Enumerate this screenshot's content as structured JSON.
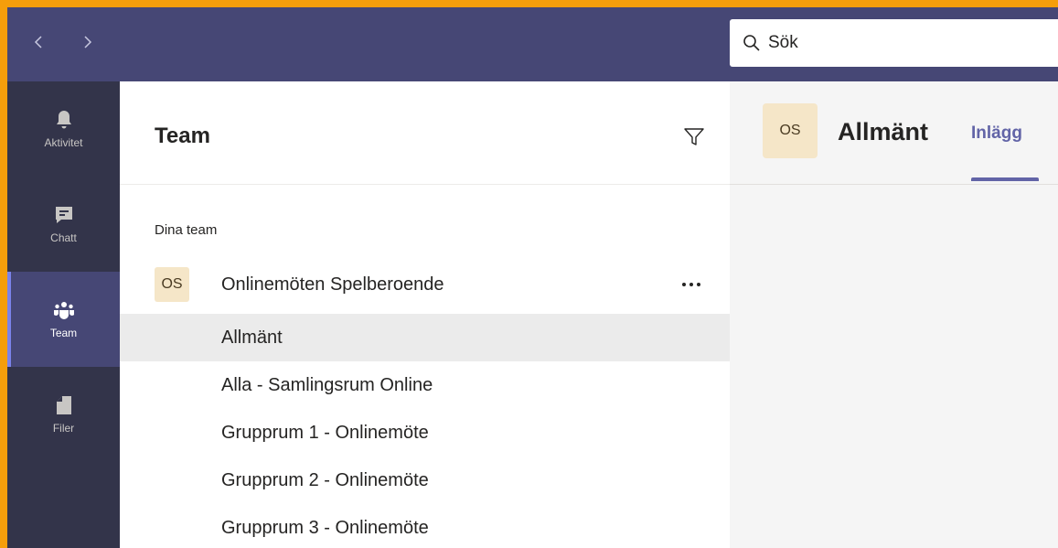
{
  "search": {
    "placeholder": "Sök"
  },
  "rail": {
    "items": [
      {
        "label": "Aktivitet"
      },
      {
        "label": "Chatt"
      },
      {
        "label": "Team"
      },
      {
        "label": "Filer"
      }
    ]
  },
  "panel": {
    "title": "Team",
    "section_label": "Dina team",
    "team": {
      "avatar": "OS",
      "name": "Onlinemöten Spelberoende"
    },
    "channels": [
      {
        "label": "Allmänt"
      },
      {
        "label": "Alla - Samlingsrum Online"
      },
      {
        "label": "Grupprum 1 - Onlinemöte"
      },
      {
        "label": "Grupprum 2 - Onlinemöte"
      },
      {
        "label": "Grupprum 3 - Onlinemöte"
      }
    ]
  },
  "main": {
    "avatar": "OS",
    "title": "Allmänt",
    "tab": "Inlägg"
  },
  "colors": {
    "frame_border": "#f59e0b",
    "topbar": "#464775",
    "rail": "#33344a",
    "accent": "#6264a7"
  }
}
